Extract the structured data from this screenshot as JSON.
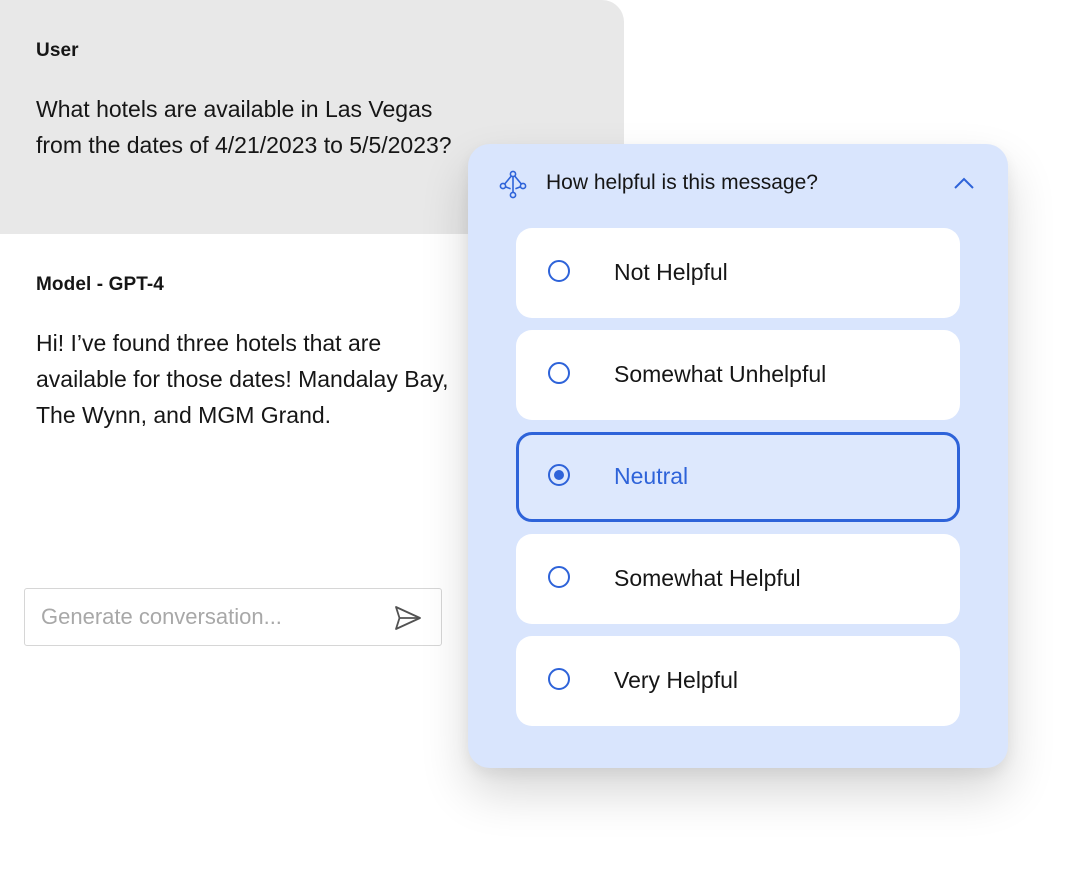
{
  "colors": {
    "accent": "#2e63d9",
    "panel_bg": "#d9e5fd",
    "user_bg": "#e8e8e8"
  },
  "conversation": {
    "user": {
      "label": "User",
      "text": "What hotels are available in Las Vegas from the dates of 4/21/2023 to 5/5/2023?"
    },
    "model": {
      "label": "Model - GPT-4",
      "text": "Hi! I’ve found three hotels that are available for those dates! Mandalay Bay, The Wynn, and MGM Grand."
    }
  },
  "composer": {
    "placeholder": "Generate conversation...",
    "value": "",
    "send_icon": "send-icon"
  },
  "feedback": {
    "icon": "ai-model-icon",
    "title": "How helpful is this message?",
    "collapse_icon": "chevron-up-icon",
    "selected_index": 2,
    "options": [
      {
        "label": "Not Helpful"
      },
      {
        "label": "Somewhat Unhelpful"
      },
      {
        "label": "Neutral"
      },
      {
        "label": "Somewhat Helpful"
      },
      {
        "label": "Very Helpful"
      }
    ]
  }
}
